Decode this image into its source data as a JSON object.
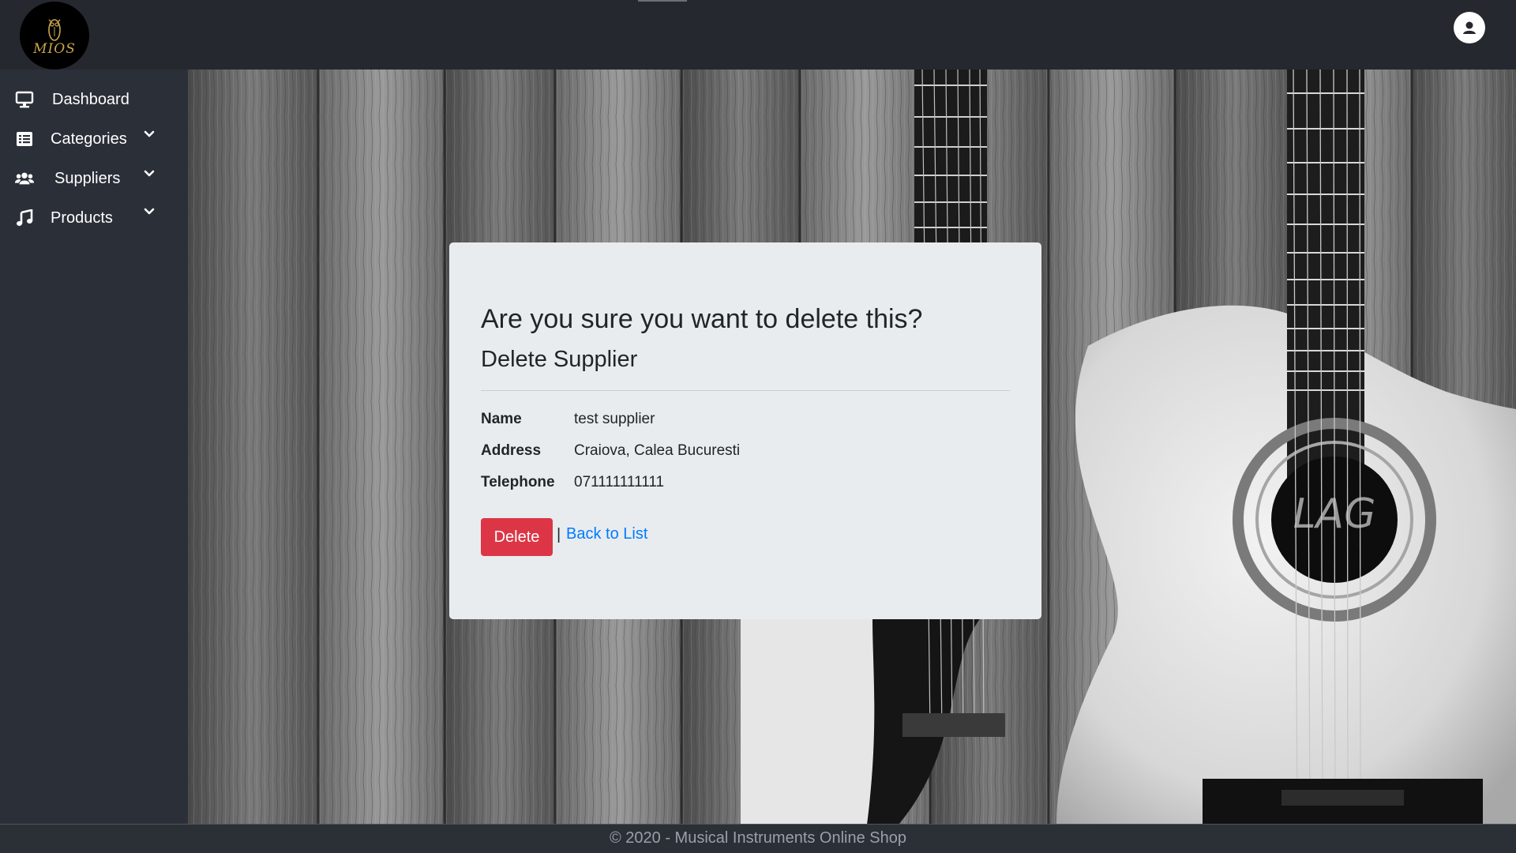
{
  "header": {
    "logo_text": "MIOS",
    "logo_icon": "owl-icon",
    "user_icon": "user-circle-icon"
  },
  "sidebar": {
    "items": [
      {
        "label": "Dashboard",
        "icon": "monitor-icon",
        "has_chevron": false
      },
      {
        "label": "Categories",
        "icon": "list-icon",
        "has_chevron": true
      },
      {
        "label": "Suppliers",
        "icon": "users-icon",
        "has_chevron": true
      },
      {
        "label": "Products",
        "icon": "music-note-icon",
        "has_chevron": true
      }
    ]
  },
  "main": {
    "confirm_title": "Are you sure you want to delete this?",
    "subtitle": "Delete Supplier",
    "details": [
      {
        "label": "Name",
        "value": "test supplier"
      },
      {
        "label": "Address",
        "value": "Craiova, Calea Bucuresti"
      },
      {
        "label": "Telephone",
        "value": "071111111111"
      }
    ],
    "delete_label": "Delete",
    "separator": "|",
    "back_label": "Back to List"
  },
  "footer": {
    "text": "© 2020 - Musical Instruments Online Shop"
  },
  "colors": {
    "topbar": "#25282e",
    "sidebar": "#2b2f38",
    "card": "#e9ecef",
    "danger": "#dc3545",
    "link": "#007bff"
  }
}
